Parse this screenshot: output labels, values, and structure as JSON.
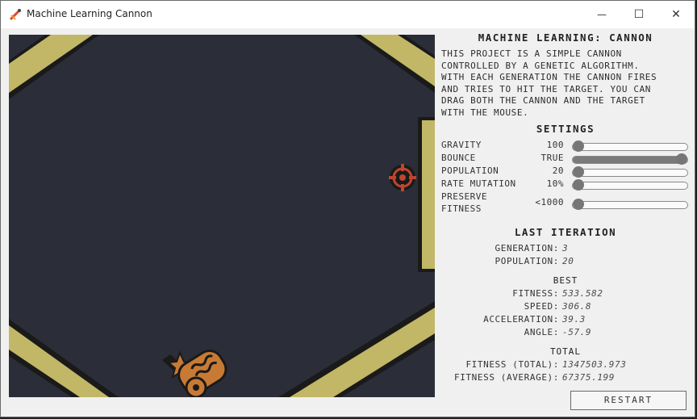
{
  "window": {
    "title": "Machine Learning Cannon",
    "minimize_glyph": "—",
    "maximize_glyph": "☐",
    "close_glyph": "✕"
  },
  "game": {
    "background": "#2b2e38",
    "wall_color": "#c1b766",
    "target_color": "#c0452e",
    "cannon_color": "#c87a35"
  },
  "panel": {
    "title": "MACHINE LEARNING: CANNON",
    "description": [
      "THIS PROJECT IS A SIMPLE CANNON",
      "CONTROLLED BY A GENETIC ALGORITHM.",
      "WITH EACH GENERATION THE CANNON FIRES",
      "AND TRIES TO HIT THE TARGET. YOU CAN",
      "DRAG BOTH THE CANNON AND THE TARGET",
      "WITH THE MOUSE."
    ],
    "settings_title": "SETTINGS",
    "settings": [
      {
        "label": "GRAVITY",
        "value": "100",
        "level": 0.0
      },
      {
        "label": "BOUNCE",
        "value": "TRUE",
        "level": 1.0
      },
      {
        "label": "POPULATION",
        "value": "20",
        "level": 0.0
      },
      {
        "label": "RATE MUTATION",
        "value": "10%",
        "level": 0.0
      },
      {
        "label_line1": "PRESERVE",
        "label_line2": "FITNESS",
        "value": "<1000",
        "level": 0.0
      }
    ],
    "last_iteration_title": "LAST ITERATION",
    "generation_label": "GENERATION:",
    "generation_value": "3",
    "population_label": "POPULATION:",
    "population_value": "20",
    "best_title": "BEST",
    "best": [
      {
        "label": "FITNESS:",
        "value": "533.582"
      },
      {
        "label": "SPEED:",
        "value": "306.8"
      },
      {
        "label": "ACCELERATION:",
        "value": "39.3"
      },
      {
        "label": "ANGLE:",
        "value": "-57.9"
      }
    ],
    "total_title": "TOTAL",
    "totals": [
      {
        "label": "FITNESS (TOTAL):",
        "value": "1347503.973"
      },
      {
        "label": "FITNESS (AVERAGE):",
        "value": "67375.199"
      }
    ],
    "restart_label": "RESTART"
  }
}
